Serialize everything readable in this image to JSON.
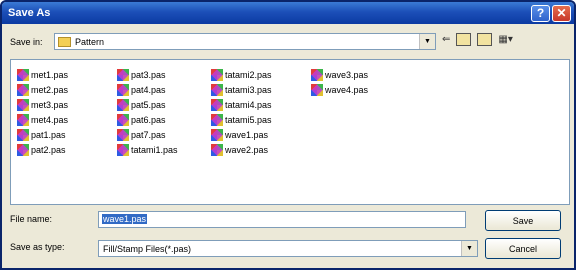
{
  "window": {
    "title": "Save As"
  },
  "titlebar_buttons": {
    "help": "?",
    "close": "✕"
  },
  "save_in": {
    "label": "Save in:",
    "value": "Pattern"
  },
  "files": {
    "col1": [
      "met1.pas",
      "met2.pas",
      "met3.pas",
      "met4.pas",
      "pat1.pas",
      "pat2.pas"
    ],
    "col2": [
      "pat3.pas",
      "pat4.pas",
      "pat5.pas",
      "pat6.pas",
      "pat7.pas",
      "tatami1.pas"
    ],
    "col3": [
      "tatami2.pas",
      "tatami3.pas",
      "tatami4.pas",
      "tatami5.pas",
      "wave1.pas",
      "wave2.pas"
    ],
    "col4": [
      "wave3.pas",
      "wave4.pas"
    ]
  },
  "file_name": {
    "label": "File name:",
    "value": "wave1.pas"
  },
  "save_as_type": {
    "label": "Save as type:",
    "value": "Fill/Stamp Files(*.pas)"
  },
  "buttons": {
    "save": "Save",
    "cancel": "Cancel"
  },
  "colors": {
    "title_bar": "#1c4fb8",
    "selection": "#316ac5",
    "dialog_bg": "#ece9d8"
  }
}
